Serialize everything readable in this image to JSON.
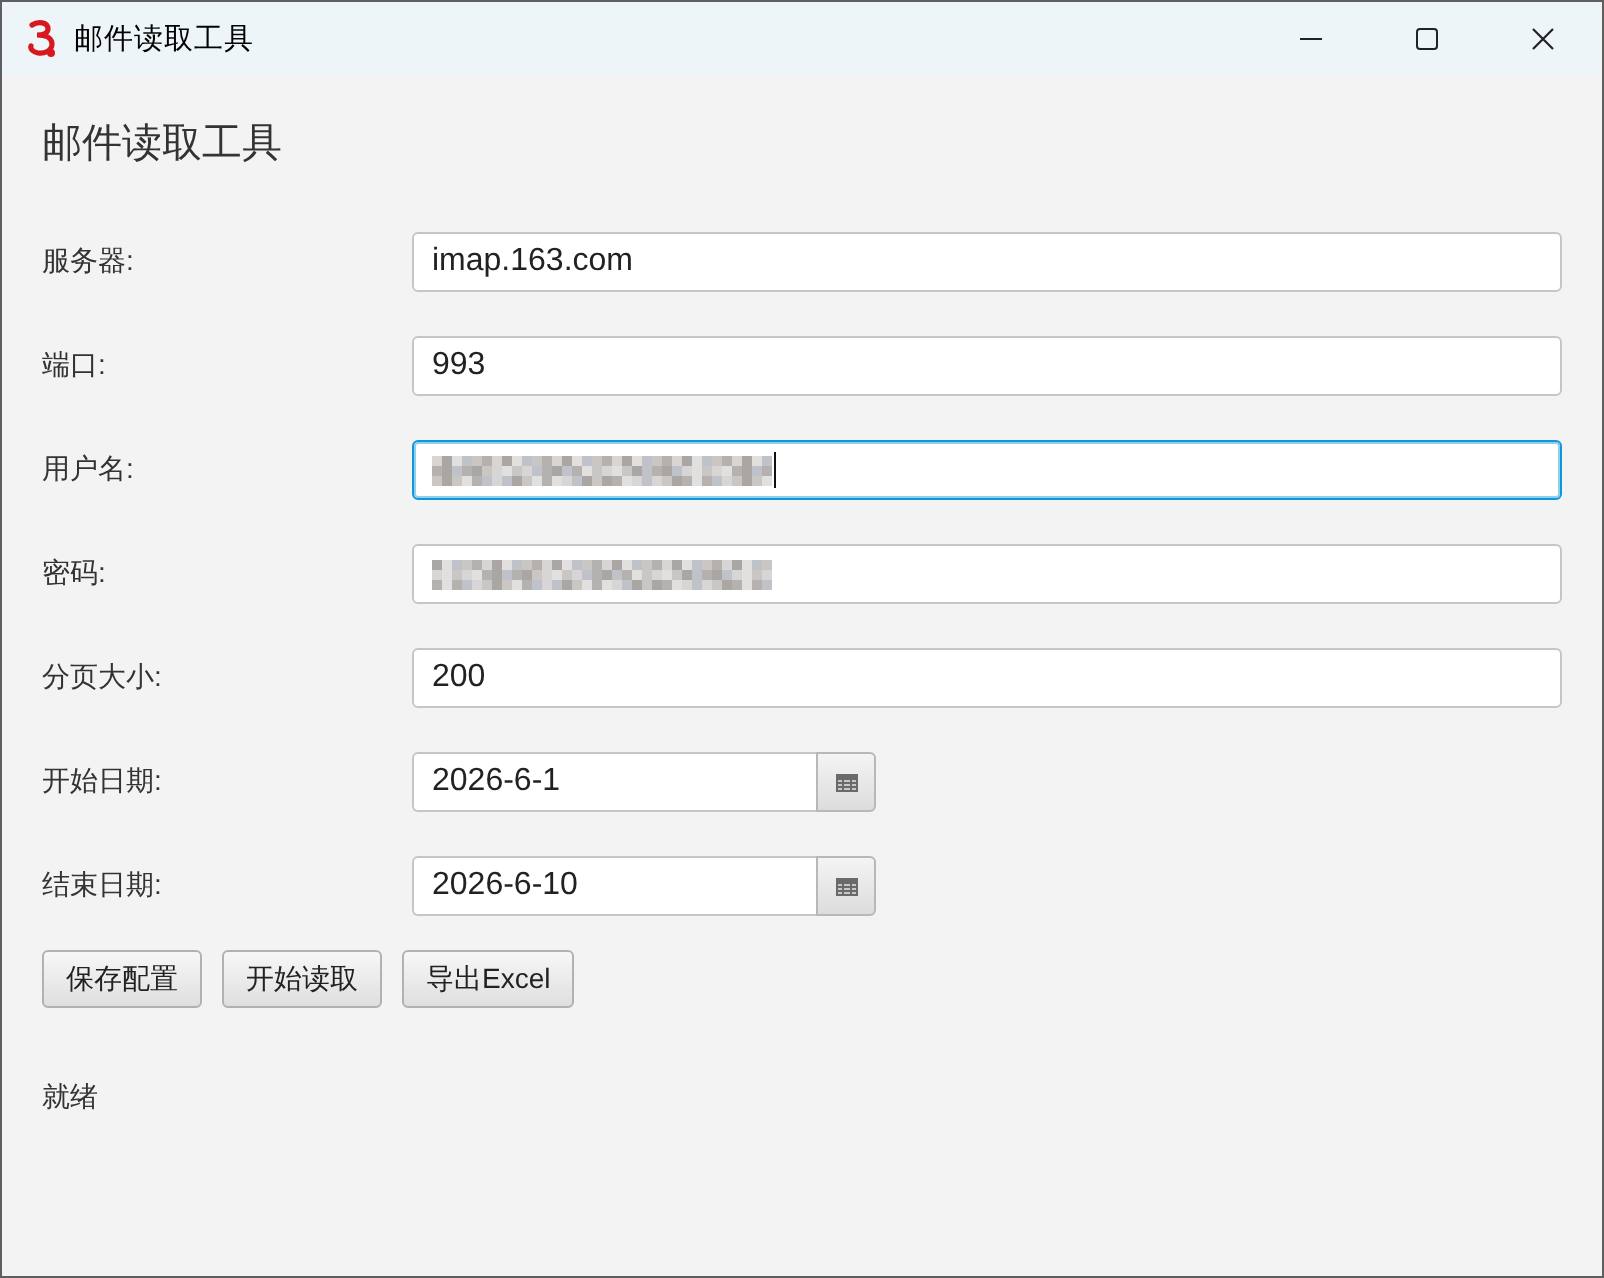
{
  "window": {
    "title": "邮件读取工具"
  },
  "heading": "邮件读取工具",
  "fields": [
    {
      "label": "服务器:",
      "kind": "text",
      "value": "imap.163.com",
      "focused": false
    },
    {
      "label": "端口:",
      "kind": "text",
      "value": "993",
      "focused": false
    },
    {
      "label": "用户名:",
      "kind": "redacted",
      "focused": true
    },
    {
      "label": "密码:",
      "kind": "redacted",
      "focused": false
    },
    {
      "label": "分页大小:",
      "kind": "text",
      "value": "200",
      "focused": false
    },
    {
      "label": "开始日期:",
      "kind": "date",
      "value": "2026-6-1",
      "focused": false
    },
    {
      "label": "结束日期:",
      "kind": "date",
      "value": "2026-6-10",
      "focused": false
    }
  ],
  "buttons": [
    "保存配置",
    "开始读取",
    "导出Excel"
  ],
  "status": "就绪"
}
